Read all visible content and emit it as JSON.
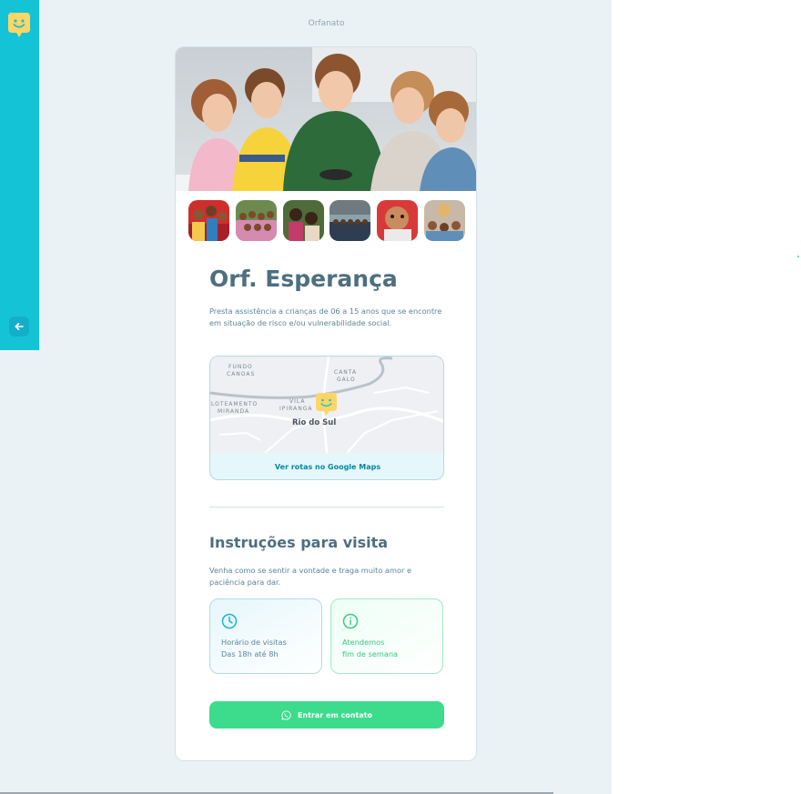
{
  "header": {
    "title": "Orfanato"
  },
  "orphanage": {
    "name": "Orf. Esperança",
    "about": "Presta assistência a crianças de 06 a 15 anos que se encontre em situação de risco e/ou vulnerabilidade social.",
    "map": {
      "labels": [
        "FUNDO",
        "CANOAS",
        "CANTA",
        "GALO",
        "LOTEAMENTO",
        "MIRANDA",
        "VILA",
        "IPIRANGA",
        "Rio do Sul"
      ],
      "link_label": "Ver rotas no Google Maps"
    },
    "visit": {
      "title": "Instruções para visita",
      "instructions": "Venha como se sentir a vontade e traga muito amor e paciência para dar.",
      "hours_line1": "Horário de visitas",
      "hours_line2": "Das 18h até 8h",
      "weekend_line1": "Atendemos",
      "weekend_line2": "fim de semana"
    },
    "contact_label": "Entrar em contato"
  },
  "icons": {
    "logo": "happy-map-marker-icon",
    "back": "arrow-left-icon",
    "hours": "clock-icon",
    "weekend": "info-icon",
    "contact": "whatsapp-icon"
  },
  "colors": {
    "sidebar": "#15c3d6",
    "primary_text": "#4d6f80",
    "accent_yellow": "#ffd666",
    "contact_green": "#3cdc8c",
    "link_blue": "#0089a5"
  }
}
